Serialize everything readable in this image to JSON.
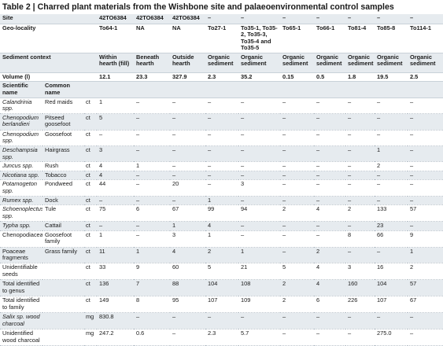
{
  "table": {
    "caption": "Table 2 | Charred plant materials from the Wishbone site and palaeoenvironmental control samples",
    "header_rows": [
      {
        "label": "Site",
        "unit": "",
        "cells": [
          "42TO6384",
          "42TO6384",
          "42TO6384",
          "–",
          "–",
          "–",
          "–",
          "–",
          "–",
          "–"
        ]
      },
      {
        "label": "Geo-locality",
        "unit": "",
        "cells": [
          "To64-1",
          "NA",
          "NA",
          "To27-1",
          "To35-1, To35-2, To35-3, To35-4 and To35-5",
          "To65-1",
          "To66-1",
          "To81-4",
          "To85-8",
          "To114-1"
        ]
      },
      {
        "label": "Sediment context",
        "unit": "",
        "cells": [
          "Within hearth (fill)",
          "Beneath hearth",
          "Outside hearth",
          "Organic sediment",
          "Organic sediment",
          "Organic sediment",
          "Organic sediment",
          "Organic sediment",
          "Organic sediment",
          "Organic sediment"
        ]
      },
      {
        "label": "Volume (l)",
        "unit": "",
        "cells": [
          "12.1",
          "23.3",
          "327.9",
          "2.3",
          "35.2",
          "0.15",
          "0.5",
          "1.8",
          "19.5",
          "2.5"
        ]
      }
    ],
    "column_headings": {
      "scientific": "Scientific name",
      "common": "Common name"
    },
    "rows": [
      {
        "scientific": "Calandrinia spp.",
        "common": "Red maids",
        "unit": "ct",
        "italic": true,
        "cells": [
          "1",
          "–",
          "–",
          "–",
          "–",
          "–",
          "–",
          "–",
          "–",
          "–"
        ]
      },
      {
        "scientific": "Chenopodium berlandieri",
        "common": "Pitseed goosefoot",
        "unit": "ct",
        "italic": true,
        "cells": [
          "5",
          "–",
          "–",
          "–",
          "–",
          "–",
          "–",
          "–",
          "–",
          "–"
        ]
      },
      {
        "scientific": "Chenopodium spp.",
        "common": "Goosefoot",
        "unit": "ct",
        "italic": true,
        "cells": [
          "–",
          "–",
          "–",
          "–",
          "–",
          "–",
          "–",
          "–",
          "–",
          "–"
        ]
      },
      {
        "scientific": "Deschampsia spp.",
        "common": "Hairgrass",
        "unit": "ct",
        "italic": true,
        "cells": [
          "3",
          "–",
          "–",
          "–",
          "–",
          "–",
          "–",
          "–",
          "1",
          "–"
        ]
      },
      {
        "scientific": "Juncus spp.",
        "common": "Rush",
        "unit": "ct",
        "italic": true,
        "cells": [
          "4",
          "1",
          "–",
          "–",
          "–",
          "–",
          "–",
          "–",
          "2",
          "–"
        ]
      },
      {
        "scientific": "Nicotiana spp.",
        "common": "Tobacco",
        "unit": "ct",
        "italic": true,
        "cells": [
          "4",
          "–",
          "–",
          "–",
          "–",
          "–",
          "–",
          "–",
          "–",
          "–"
        ]
      },
      {
        "scientific": "Potamogeton spp.",
        "common": "Pondweed",
        "unit": "ct",
        "italic": true,
        "cells": [
          "44",
          "–",
          "20",
          "–",
          "3",
          "–",
          "–",
          "–",
          "–",
          "–"
        ]
      },
      {
        "scientific": "Rumex spp.",
        "common": "Dock",
        "unit": "ct",
        "italic": true,
        "cells": [
          "–",
          "–",
          "–",
          "1",
          "–",
          "–",
          "–",
          "–",
          "–",
          "–"
        ]
      },
      {
        "scientific": "Schoenoplectus spp.",
        "common": "Tule",
        "unit": "ct",
        "italic": true,
        "cells": [
          "75",
          "6",
          "67",
          "99",
          "94",
          "2",
          "4",
          "2",
          "133",
          "57"
        ]
      },
      {
        "scientific": "Typha spp.",
        "common": "Cattail",
        "unit": "ct",
        "italic": true,
        "cells": [
          "–",
          "–",
          "1",
          "4",
          "–",
          "–",
          "–",
          "–",
          "23",
          "–"
        ]
      },
      {
        "scientific": "Chenopodiaceae",
        "common": "Goosefoot family",
        "unit": "ct",
        "italic": false,
        "cells": [
          "1",
          "–",
          "3",
          "1",
          "–",
          "–",
          "–",
          "8",
          "66",
          "9"
        ]
      },
      {
        "scientific": "Poaceae fragments",
        "common": "Grass family",
        "unit": "ct",
        "italic": false,
        "cells": [
          "11",
          "1",
          "4",
          "2",
          "1",
          "–",
          "2",
          "–",
          "–",
          "1"
        ]
      },
      {
        "scientific": "Unidentifiable seeds",
        "common": "",
        "unit": "ct",
        "italic": false,
        "cells": [
          "33",
          "9",
          "60",
          "5",
          "21",
          "5",
          "4",
          "3",
          "16",
          "2"
        ]
      },
      {
        "scientific": "Total identified to genus",
        "common": "",
        "unit": "ct",
        "italic": false,
        "cells": [
          "136",
          "7",
          "88",
          "104",
          "108",
          "2",
          "4",
          "160",
          "104",
          "57"
        ]
      },
      {
        "scientific": "Total identified to family",
        "common": "",
        "unit": "ct",
        "italic": false,
        "cells": [
          "149",
          "8",
          "95",
          "107",
          "109",
          "2",
          "6",
          "226",
          "107",
          "67"
        ]
      },
      {
        "scientific": "Salix sp. wood charcoal",
        "common": "",
        "unit": "mg",
        "italic": true,
        "cells": [
          "830.8",
          "–",
          "–",
          "–",
          "–",
          "–",
          "–",
          "–",
          "–",
          "–"
        ]
      },
      {
        "scientific": "Unidentified wood charcoal",
        "common": "",
        "unit": "mg",
        "italic": false,
        "cells": [
          "247.2",
          "0.6",
          "–",
          "2.3",
          "5.7",
          "–",
          "–",
          "–",
          "275.0",
          "–"
        ]
      }
    ]
  }
}
